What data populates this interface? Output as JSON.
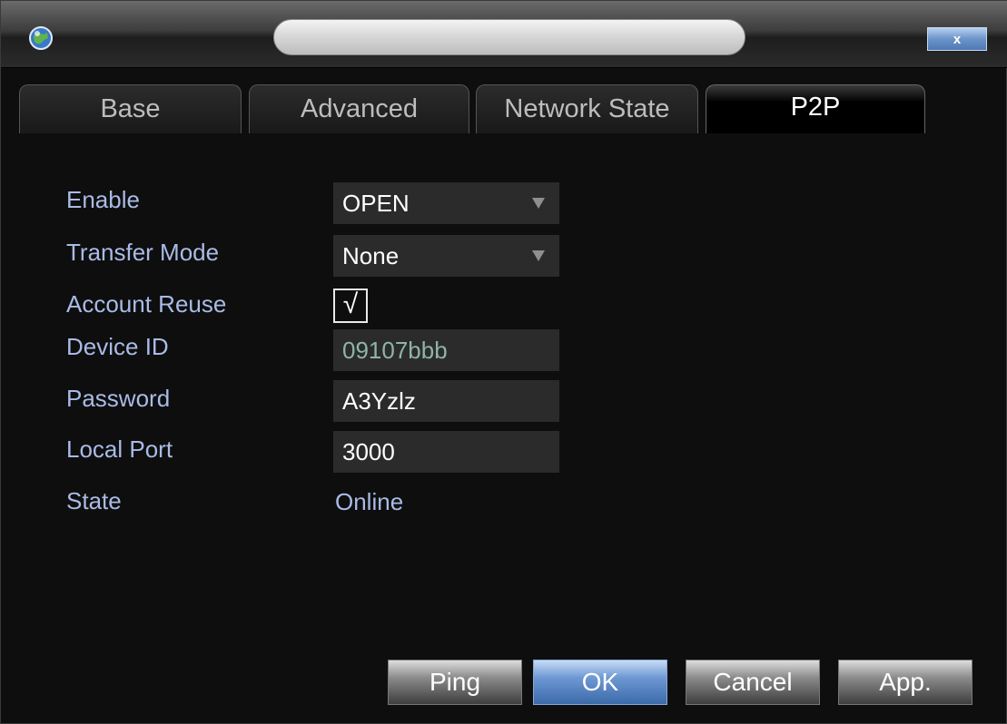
{
  "window": {
    "close_label": "x"
  },
  "tabs": [
    {
      "label": "Base"
    },
    {
      "label": "Advanced"
    },
    {
      "label": "Network State"
    },
    {
      "label": "P2P"
    }
  ],
  "active_tab": "P2P",
  "form": {
    "enable": {
      "label": "Enable",
      "value": "OPEN"
    },
    "transfer_mode": {
      "label": "Transfer Mode",
      "value": "None"
    },
    "account_reuse": {
      "label": "Account Reuse",
      "checked": true,
      "check_glyph": "√"
    },
    "device_id": {
      "label": "Device ID",
      "value": "09107bbb"
    },
    "password": {
      "label": "Password",
      "value": "A3Yzlz"
    },
    "local_port": {
      "label": "Local Port",
      "value": "3000"
    },
    "state": {
      "label": "State",
      "value": "Online"
    }
  },
  "buttons": {
    "ping": "Ping",
    "ok": "OK",
    "cancel": "Cancel",
    "apply": "App."
  },
  "colors": {
    "label": "#a9bbe6",
    "field_bg": "#2b2b2b",
    "primary_button": "#6d98d3"
  },
  "icons": {
    "app_logo": "globe-logo-icon",
    "dropdown": "triangle-down-icon"
  }
}
